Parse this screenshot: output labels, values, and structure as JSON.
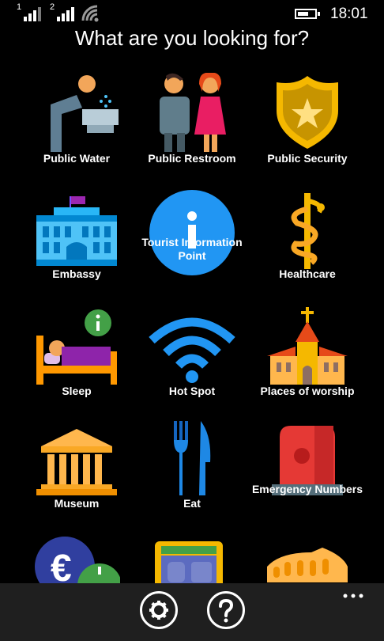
{
  "status_bar": {
    "sim1": "1",
    "sim2": "2",
    "time": "18:01"
  },
  "header": {
    "title": "What are you looking for?"
  },
  "categories": [
    {
      "label": "Public Water",
      "icon": "drinking-fountain-icon"
    },
    {
      "label": "Public Restroom",
      "icon": "restroom-people-icon"
    },
    {
      "label": "Public Security",
      "icon": "police-badge-icon"
    },
    {
      "label": "Embassy",
      "icon": "embassy-building-icon"
    },
    {
      "label": "Tourist Information Point",
      "icon": "information-icon"
    },
    {
      "label": "Healthcare",
      "icon": "caduceus-icon"
    },
    {
      "label": "Sleep",
      "icon": "bed-icon"
    },
    {
      "label": "Hot Spot",
      "icon": "wifi-icon"
    },
    {
      "label": "Places of worship",
      "icon": "church-icon"
    },
    {
      "label": "Museum",
      "icon": "museum-icon"
    },
    {
      "label": "Eat",
      "icon": "fork-knife-icon"
    },
    {
      "label": "Emergency Numbers",
      "icon": "emergency-light-icon"
    },
    {
      "label": "",
      "icon": "currency-exchange-icon"
    },
    {
      "label": "",
      "icon": "atm-icon"
    },
    {
      "label": "",
      "icon": "colosseum-icon"
    }
  ],
  "app_bar": {
    "settings_icon": "gear-icon",
    "help_icon": "question-icon",
    "more_icon": "more-dots-icon"
  },
  "colors": {
    "background": "#000000",
    "app_bar": "#1f1f1f",
    "info_blue": "#2196f3",
    "gold": "#f5b800",
    "green": "#43a047"
  }
}
